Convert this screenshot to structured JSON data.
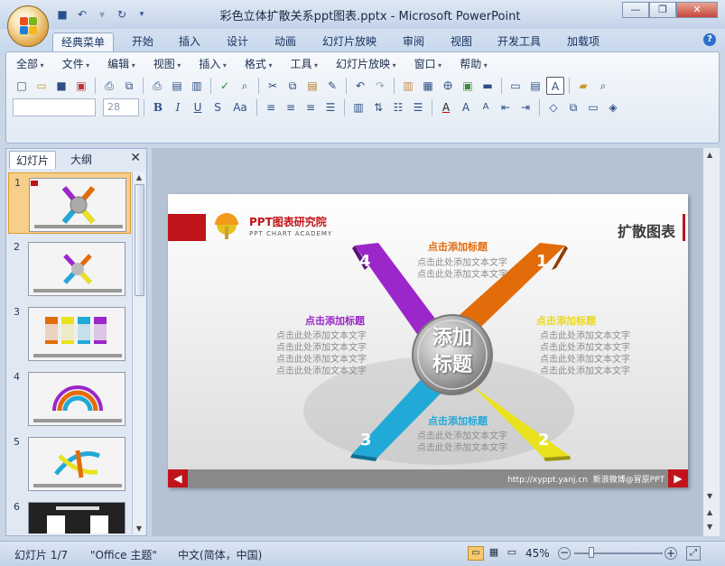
{
  "window": {
    "title": "彩色立体扩散关系ppt图表.pptx - Microsoft PowerPoint"
  },
  "tabs": [
    "经典菜单",
    "开始",
    "插入",
    "设计",
    "动画",
    "幻灯片放映",
    "审阅",
    "视图",
    "开发工具",
    "加载项"
  ],
  "menu": [
    "全部",
    "文件",
    "编辑",
    "视图",
    "插入",
    "格式",
    "工具",
    "幻灯片放映",
    "窗口",
    "帮助"
  ],
  "format": {
    "font_size": "28"
  },
  "panel": {
    "tab_slides": "幻灯片",
    "tab_outline": "大纲"
  },
  "thumbnails": [
    "1",
    "2",
    "3",
    "4",
    "5",
    "6"
  ],
  "slide": {
    "brand": "PPT图表研究院",
    "brand_en": "PPT CHART ACADEMY",
    "heading": "扩散图表",
    "center": [
      "添加",
      "标题"
    ],
    "arm_numbers": [
      "1",
      "2",
      "3",
      "4"
    ],
    "sections": {
      "top": {
        "title": "点击添加标题",
        "lines": [
          "点击此处添加文本文字",
          "点击此处添加文本文字"
        ]
      },
      "left": {
        "title": "点击添加标题",
        "lines": [
          "点击此处添加文本文字",
          "点击此处添加文本文字",
          "点击此处添加文本文字",
          "点击此处添加文本文字"
        ]
      },
      "right": {
        "title": "点击添加标题",
        "lines": [
          "点击此处添加文本文字",
          "点击此处添加文本文字",
          "点击此处添加文本文字",
          "点击此处添加文本文字"
        ]
      },
      "bottom": {
        "title": "点击添加标题",
        "lines": [
          "点击此处添加文本文字",
          "点击此处添加文本文字"
        ]
      }
    },
    "footer": "http://xyppt.yanj.cn  新浪微博@冒原PPT",
    "colors": {
      "orange": "#e36c0a",
      "yellow": "#e9e21f",
      "blue": "#21a9d8",
      "purple": "#9b26c9",
      "red": "#c0141a"
    }
  },
  "status": {
    "slide_info": "幻灯片 1/7",
    "theme": "\"Office 主题\"",
    "language": "中文(简体，中国)",
    "zoom": "45%"
  }
}
